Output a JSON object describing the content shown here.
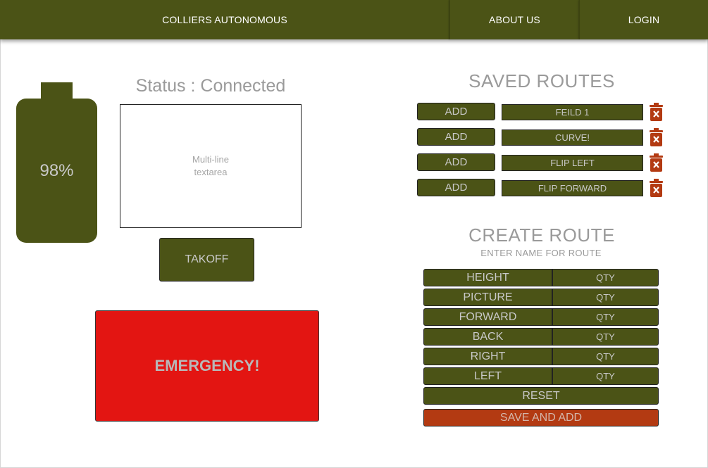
{
  "nav": {
    "brand": "COLLIERS AUTONOMOUS",
    "about": "ABOUT US",
    "login": "LOGIN"
  },
  "battery": {
    "level_text": "98%"
  },
  "status": {
    "text": "Status : Connected"
  },
  "log": {
    "placeholder": "Multi-line\ntextarea"
  },
  "controls": {
    "takeoff_label": "TAKOFF",
    "emergency_label": "EMERGENCY!"
  },
  "saved_routes": {
    "heading": "SAVED ROUTES",
    "add_label": "ADD",
    "items": [
      {
        "name": "FEILD 1"
      },
      {
        "name": "CURVE!"
      },
      {
        "name": "FLIP LEFT"
      },
      {
        "name": "FLIP FORWARD"
      }
    ]
  },
  "create_route": {
    "heading": "CREATE ROUTE",
    "subheading": "ENTER NAME FOR ROUTE",
    "qty_placeholder": "QTY",
    "params": [
      {
        "label": "HEIGHT"
      },
      {
        "label": "PICTURE"
      },
      {
        "label": "FORWARD"
      },
      {
        "label": "BACK"
      },
      {
        "label": "RIGHT"
      },
      {
        "label": "LEFT"
      }
    ],
    "reset_label": "RESET",
    "save_label": "SAVE AND ADD"
  },
  "colors": {
    "primary": "#4b5316",
    "emergency": "#e31512",
    "delete": "#b33a12"
  },
  "icons": {
    "delete": "trash-icon"
  }
}
